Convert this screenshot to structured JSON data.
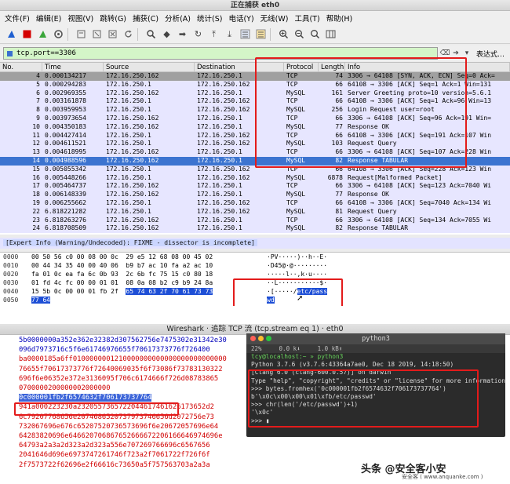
{
  "window": {
    "title": "正在捕获 eth0"
  },
  "menu": [
    "文件(F)",
    "编辑(E)",
    "视图(V)",
    "跳转(G)",
    "捕获(C)",
    "分析(A)",
    "统计(S)",
    "电话(Y)",
    "无线(W)",
    "工具(T)",
    "帮助(H)"
  ],
  "toolbar_icons": [
    "shark-fin-icon",
    "stop-icon",
    "restart-icon",
    "options-icon",
    "open-icon",
    "save-icon",
    "close-file-icon",
    "reload-icon",
    "find-icon",
    "back-icon",
    "forward-icon",
    "goto-icon",
    "first-icon",
    "last-icon",
    "autoscroll-icon",
    "colorize-icon",
    "zoom-in-icon",
    "zoom-out-icon",
    "zoom-reset-icon",
    "resize-columns-icon"
  ],
  "filter": {
    "value": "tcp.port==3306",
    "expression_label": "表达式…"
  },
  "columns": {
    "no": "No.",
    "time": "Time",
    "src": "Source",
    "dst": "Destination",
    "proto": "Protocol",
    "len": "Length",
    "info": "Info"
  },
  "packets": [
    {
      "no": "4",
      "time": "0.000134217",
      "src": "172.16.250.162",
      "dst": "172.16.250.1",
      "proto": "TCP",
      "len": "74",
      "info": "3306 → 64108 [SYN, ACK, ECN] Seq=0 Ack=",
      "bg": "#a0a0a0",
      "fg": "#000000"
    },
    {
      "no": "5",
      "time": "0.000294283",
      "src": "172.16.250.1",
      "dst": "172.16.250.162",
      "proto": "TCP",
      "len": "66",
      "info": "64108 → 3306 [ACK] Seq=1 Ack=1 Win=131",
      "bg": "#e7e6ff",
      "fg": "#000000"
    },
    {
      "no": "6",
      "time": "0.002969355",
      "src": "172.16.250.162",
      "dst": "172.16.250.1",
      "proto": "MySQL",
      "len": "161",
      "info": "Server Greeting proto=10 version=5.6.1",
      "bg": "#e7e6ff",
      "fg": "#000000"
    },
    {
      "no": "7",
      "time": "0.003161878",
      "src": "172.16.250.1",
      "dst": "172.16.250.162",
      "proto": "TCP",
      "len": "66",
      "info": "64108 → 3306 [ACK] Seq=1 Ack=96 Win=13",
      "bg": "#e7e6ff",
      "fg": "#000000"
    },
    {
      "no": "8",
      "time": "0.003959953",
      "src": "172.16.250.1",
      "dst": "172.16.250.162",
      "proto": "MySQL",
      "len": "256",
      "info": "Login Request user=root",
      "bg": "#e7e6ff",
      "fg": "#000000"
    },
    {
      "no": "9",
      "time": "0.003973654",
      "src": "172.16.250.162",
      "dst": "172.16.250.1",
      "proto": "TCP",
      "len": "66",
      "info": "3306 → 64108 [ACK] Seq=96 Ack=191 Win=",
      "bg": "#e7e6ff",
      "fg": "#000000"
    },
    {
      "no": "10",
      "time": "0.004350183",
      "src": "172.16.250.162",
      "dst": "172.16.250.1",
      "proto": "MySQL",
      "len": "77",
      "info": "Response OK",
      "bg": "#e7e6ff",
      "fg": "#000000"
    },
    {
      "no": "11",
      "time": "0.004427414",
      "src": "172.16.250.1",
      "dst": "172.16.250.162",
      "proto": "TCP",
      "len": "66",
      "info": "64108 → 3306 [ACK] Seq=191 Ack=107 Win",
      "bg": "#e7e6ff",
      "fg": "#000000"
    },
    {
      "no": "12",
      "time": "0.004611521",
      "src": "172.16.250.1",
      "dst": "172.16.250.162",
      "proto": "MySQL",
      "len": "103",
      "info": "Request Query",
      "bg": "#e7e6ff",
      "fg": "#000000"
    },
    {
      "no": "13",
      "time": "0.004618995",
      "src": "172.16.250.162",
      "dst": "172.16.250.1",
      "proto": "TCP",
      "len": "66",
      "info": "3306 → 64108 [ACK] Seq=107 Ack=228 Win",
      "bg": "#e7e6ff",
      "fg": "#000000"
    },
    {
      "no": "14",
      "time": "0.004988596",
      "src": "172.16.250.162",
      "dst": "172.16.250.1",
      "proto": "MySQL",
      "len": "82",
      "info": "Response TABULAR",
      "bg": "#3c74d0",
      "fg": "#ffffff"
    },
    {
      "no": "15",
      "time": "0.005055342",
      "src": "172.16.250.1",
      "dst": "172.16.250.162",
      "proto": "TCP",
      "len": "66",
      "info": "64108 → 3306 [ACK] Seq=228 Ack=123 Win",
      "bg": "#e7e6ff",
      "fg": "#000000"
    },
    {
      "no": "16",
      "time": "0.005448266",
      "src": "172.16.250.1",
      "dst": "172.16.250.162",
      "proto": "MySQL",
      "len": "6878",
      "info": "Request[Malformed Packet]",
      "bg": "#e7e6ff",
      "fg": "#000000"
    },
    {
      "no": "17",
      "time": "0.005464737",
      "src": "172.16.250.162",
      "dst": "172.16.250.1",
      "proto": "TCP",
      "len": "66",
      "info": "3306 → 64108 [ACK] Seq=123 Ack=7040 Wi",
      "bg": "#e7e6ff",
      "fg": "#000000"
    },
    {
      "no": "18",
      "time": "0.006148339",
      "src": "172.16.250.162",
      "dst": "172.16.250.1",
      "proto": "MySQL",
      "len": "77",
      "info": "Response OK",
      "bg": "#e7e6ff",
      "fg": "#000000"
    },
    {
      "no": "19",
      "time": "0.006255662",
      "src": "172.16.250.1",
      "dst": "172.16.250.162",
      "proto": "TCP",
      "len": "66",
      "info": "64108 → 3306 [ACK] Seq=7040 Ack=134 Wi",
      "bg": "#e7e6ff",
      "fg": "#000000"
    },
    {
      "no": "22",
      "time": "6.818221282",
      "src": "172.16.250.1",
      "dst": "172.16.250.162",
      "proto": "MySQL",
      "len": "81",
      "info": "Request Query",
      "bg": "#e7e6ff",
      "fg": "#000000"
    },
    {
      "no": "23",
      "time": "6.818263276",
      "src": "172.16.250.162",
      "dst": "172.16.250.1",
      "proto": "TCP",
      "len": "66",
      "info": "3306 → 64108 [ACK] Seq=134 Ack=7055 Wi",
      "bg": "#e7e6ff",
      "fg": "#000000"
    },
    {
      "no": "24",
      "time": "6.818708509",
      "src": "172.16.250.162",
      "dst": "172.16.250.1",
      "proto": "MySQL",
      "len": "82",
      "info": "Response TABULAR",
      "bg": "#e7e6ff",
      "fg": "#000000"
    }
  ],
  "expert_info": "[Expert Info (Warning/Undecoded): FIXME - dissector is incomplete]",
  "hex_rows": [
    {
      "off": "0000",
      "bytes": "00 50 56 c0 00 08 00 0c  29 e5 12 68 08 00 45 02",
      "ascii": "·PV·····)··h··E·"
    },
    {
      "off": "0010",
      "bytes": "00 44 34 35 40 00 40 06  b9 b7 ac 10 fa a2 ac 10",
      "ascii": "·D45@·@·········"
    },
    {
      "off": "0020",
      "bytes": "fa 01 0c ea fa 6c 0b 93  2c 6b fc 75 15 c0 80 18",
      "ascii": "·····l··,k·u····"
    },
    {
      "off": "0030",
      "bytes": "01 fd 4c fc 00 00 01 01  08 0a 08 b2 c9 b9 24 8a",
      "ascii": "··L···········$·"
    },
    {
      "off": "0040",
      "bytes_a": "15 5b 0c 00 00 01 fb 2f  ",
      "bytes_hl": "65 74 63 2f 70 61 73 73",
      "ascii_a": "·[·····/",
      "ascii_hl": "etc/pass"
    },
    {
      "off": "0050",
      "bytes_a": "",
      "bytes_hl": "77 64",
      "ascii_a": "",
      "ascii_hl": "wd"
    }
  ],
  "stream": {
    "title": "Wireshark · 追踪 TCP 流 (tcp.stream eq 1) · eth0",
    "lines": [
      {
        "text": "5b0000000a352e362e32382d307562756e7475302e31342e30",
        "cls": "blue"
      },
      {
        "text": "096d7973716c5f6e61746976655f70617373776f726400",
        "cls": "blue"
      },
      {
        "text": "ba0000185a6ff0100000001210000000000000000000000000",
        "cls": ""
      },
      {
        "text": "76655f70617373776f72640069035f6f73086f73783130322",
        "cls": ""
      },
      {
        "text": "696f6e06352e372e3136095f706c6174666f726d08783865",
        "cls": ""
      },
      {
        "text": "0700000200000002000000",
        "cls": ""
      },
      {
        "text": "0c000001fb2f6574632f706173737764",
        "cls": "hlblue"
      },
      {
        "text": "941a000223230a2320557365722044617461626173652d2",
        "cls": ""
      },
      {
        "text": "6c79207768656e2074686520737973746656d2072756e73",
        "cls": ""
      },
      {
        "text": "732067696e676c65207520736573696f6e20672057696e64",
        "cls": ""
      },
      {
        "text": "64283820696e646620706867652666672206166646974696e",
        "cls": ""
      },
      {
        "text": "64793a2a3a2d323a2d323a556e707269766696c6567656",
        "cls": ""
      },
      {
        "text": "2041646d696e6973747261746f723a2f7061722f726f6f",
        "cls": ""
      },
      {
        "text": "2f7573722f62696e2f66616c73650a5f757563703a2a3a",
        "cls": ""
      }
    ]
  },
  "terminal": {
    "title": "python3",
    "stats": [
      "22%",
      "0.0 k⬇",
      "1.0 kB⬆"
    ],
    "lines": [
      {
        "text": "tcy@localhost:~ » python3",
        "cls": "t-green"
      },
      {
        "text": "Python 3.7.6 (v3.7.6:43364a7ae0, Dec 18 2019, 14:18:50)",
        "cls": ""
      },
      {
        "text": "[Clang 6.0 (clang-600.0.57)] on darwin",
        "cls": ""
      },
      {
        "text": "Type \"help\", \"copyright\", \"credits\" or \"license\" for more information.",
        "cls": ""
      },
      {
        "text": ">>> bytes.fromhex('0c000001fb2f6574632f706173737764')",
        "cls": ""
      },
      {
        "text": "b'\\x0c\\x00\\x00\\x01\\xfb/etc/passwd'",
        "cls": ""
      },
      {
        "text": ">>> chr(len('/etc/passwd')+1)",
        "cls": ""
      },
      {
        "text": "'\\x0c'",
        "cls": ""
      },
      {
        "text": ">>> ▮",
        "cls": ""
      }
    ]
  },
  "watermark": {
    "main": "头条 @安全客小安",
    "sub": "安全客 ( www.anquanke.com )"
  }
}
